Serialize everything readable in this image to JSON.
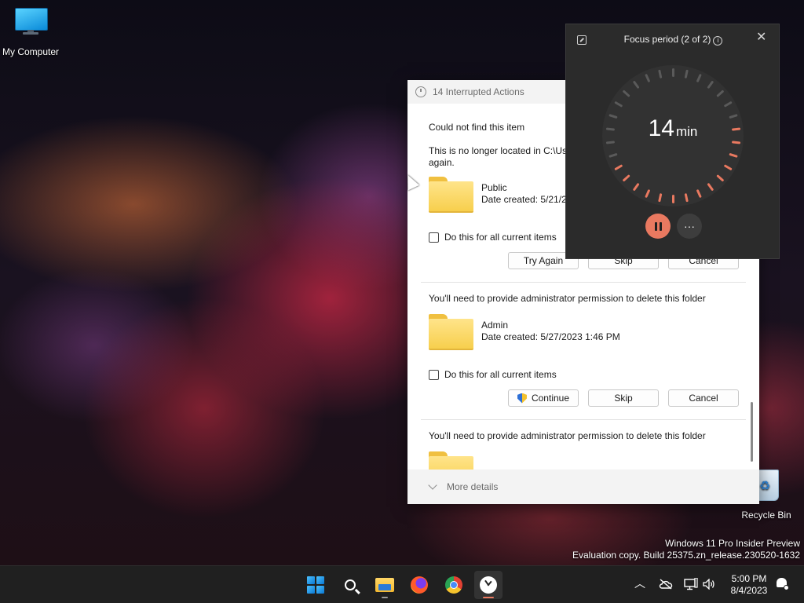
{
  "desktop": {
    "icons": [
      {
        "label": "My Computer",
        "icon": "monitor-icon"
      },
      {
        "label": "Recycle Bin",
        "icon": "recycle-bin-icon"
      }
    ],
    "watermark": {
      "line1": "Windows 11 Pro Insider Preview",
      "line2": "Evaluation copy. Build 25375.zn_release.230520-1632"
    }
  },
  "dialog": {
    "title": "14 Interrupted Actions",
    "items": [
      {
        "heading": "Could not find this item",
        "message": "This is no longer located in C:\\Use",
        "message_cont": "again.",
        "file_name": "Public",
        "file_date": "Date created: 5/21/2",
        "checkbox_label": "Do this for all current items",
        "buttons": [
          "Try Again",
          "Skip",
          "Cancel"
        ]
      },
      {
        "heading": "You'll need to provide administrator permission to delete this folder",
        "file_name": "Admin",
        "file_date": "Date created: 5/27/2023 1:46 PM",
        "checkbox_label": "Do this for all current items",
        "buttons": [
          "Continue",
          "Skip",
          "Cancel"
        ]
      },
      {
        "heading": "You'll need to provide administrator permission to delete this folder"
      }
    ],
    "footer": "More details"
  },
  "focus": {
    "title": "Focus period (2 of 2)",
    "info_glyph": "i",
    "close_glyph": "✕",
    "minutes": "14",
    "unit": "min",
    "more_glyph": "···",
    "remaining_fraction": 0.47,
    "accent": "#e97960"
  },
  "taskbar": {
    "apps": [
      "start-icon",
      "search-icon",
      "file-explorer-icon",
      "firefox-icon",
      "chrome-icon",
      "clock-app-icon"
    ],
    "active_app": "clock-app-icon",
    "tray": {
      "chevron": "︿",
      "time": "5:00 PM",
      "date": "8/4/2023"
    }
  }
}
